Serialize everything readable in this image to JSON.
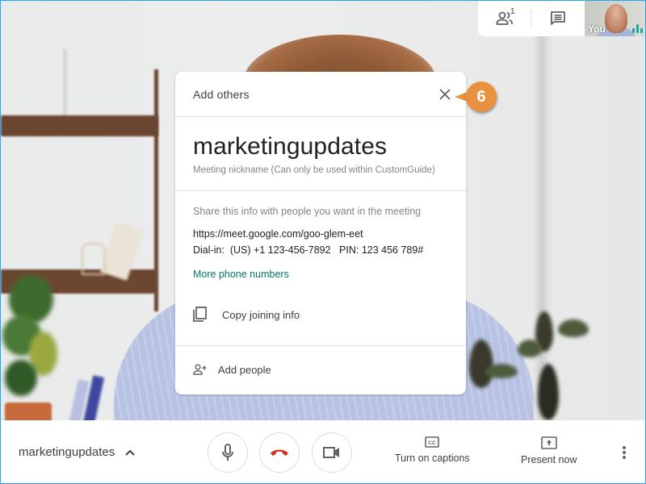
{
  "top_controls": {
    "people_count": "1",
    "self_view_label": "You"
  },
  "dialog": {
    "title": "Add others",
    "meeting_name": "marketingupdates",
    "meeting_note": "Meeting nickname (Can only be used within CustomGuide)",
    "share_text": "Share this info with people you want in the meeting",
    "link_prefix": "https://meet.google.com/",
    "link_code": "goo-glem-eet",
    "dialin_label": "Dial-in:",
    "dialin_number": "(US) +1 123-456-7892",
    "pin_label": "PIN:",
    "pin_value": "123 456 789#",
    "more_phones": "More phone numbers",
    "copy_label": "Copy joining info",
    "add_people_label": "Add people"
  },
  "callout": {
    "step": "6",
    "color": "#e8913f"
  },
  "bottombar": {
    "meeting_name": "marketingupdates",
    "captions_label": "Turn on captions",
    "present_label": "Present now",
    "hangup_color": "#d93025"
  },
  "colors": {
    "link_green": "#00796b",
    "frame_border": "#2ea3e8"
  }
}
